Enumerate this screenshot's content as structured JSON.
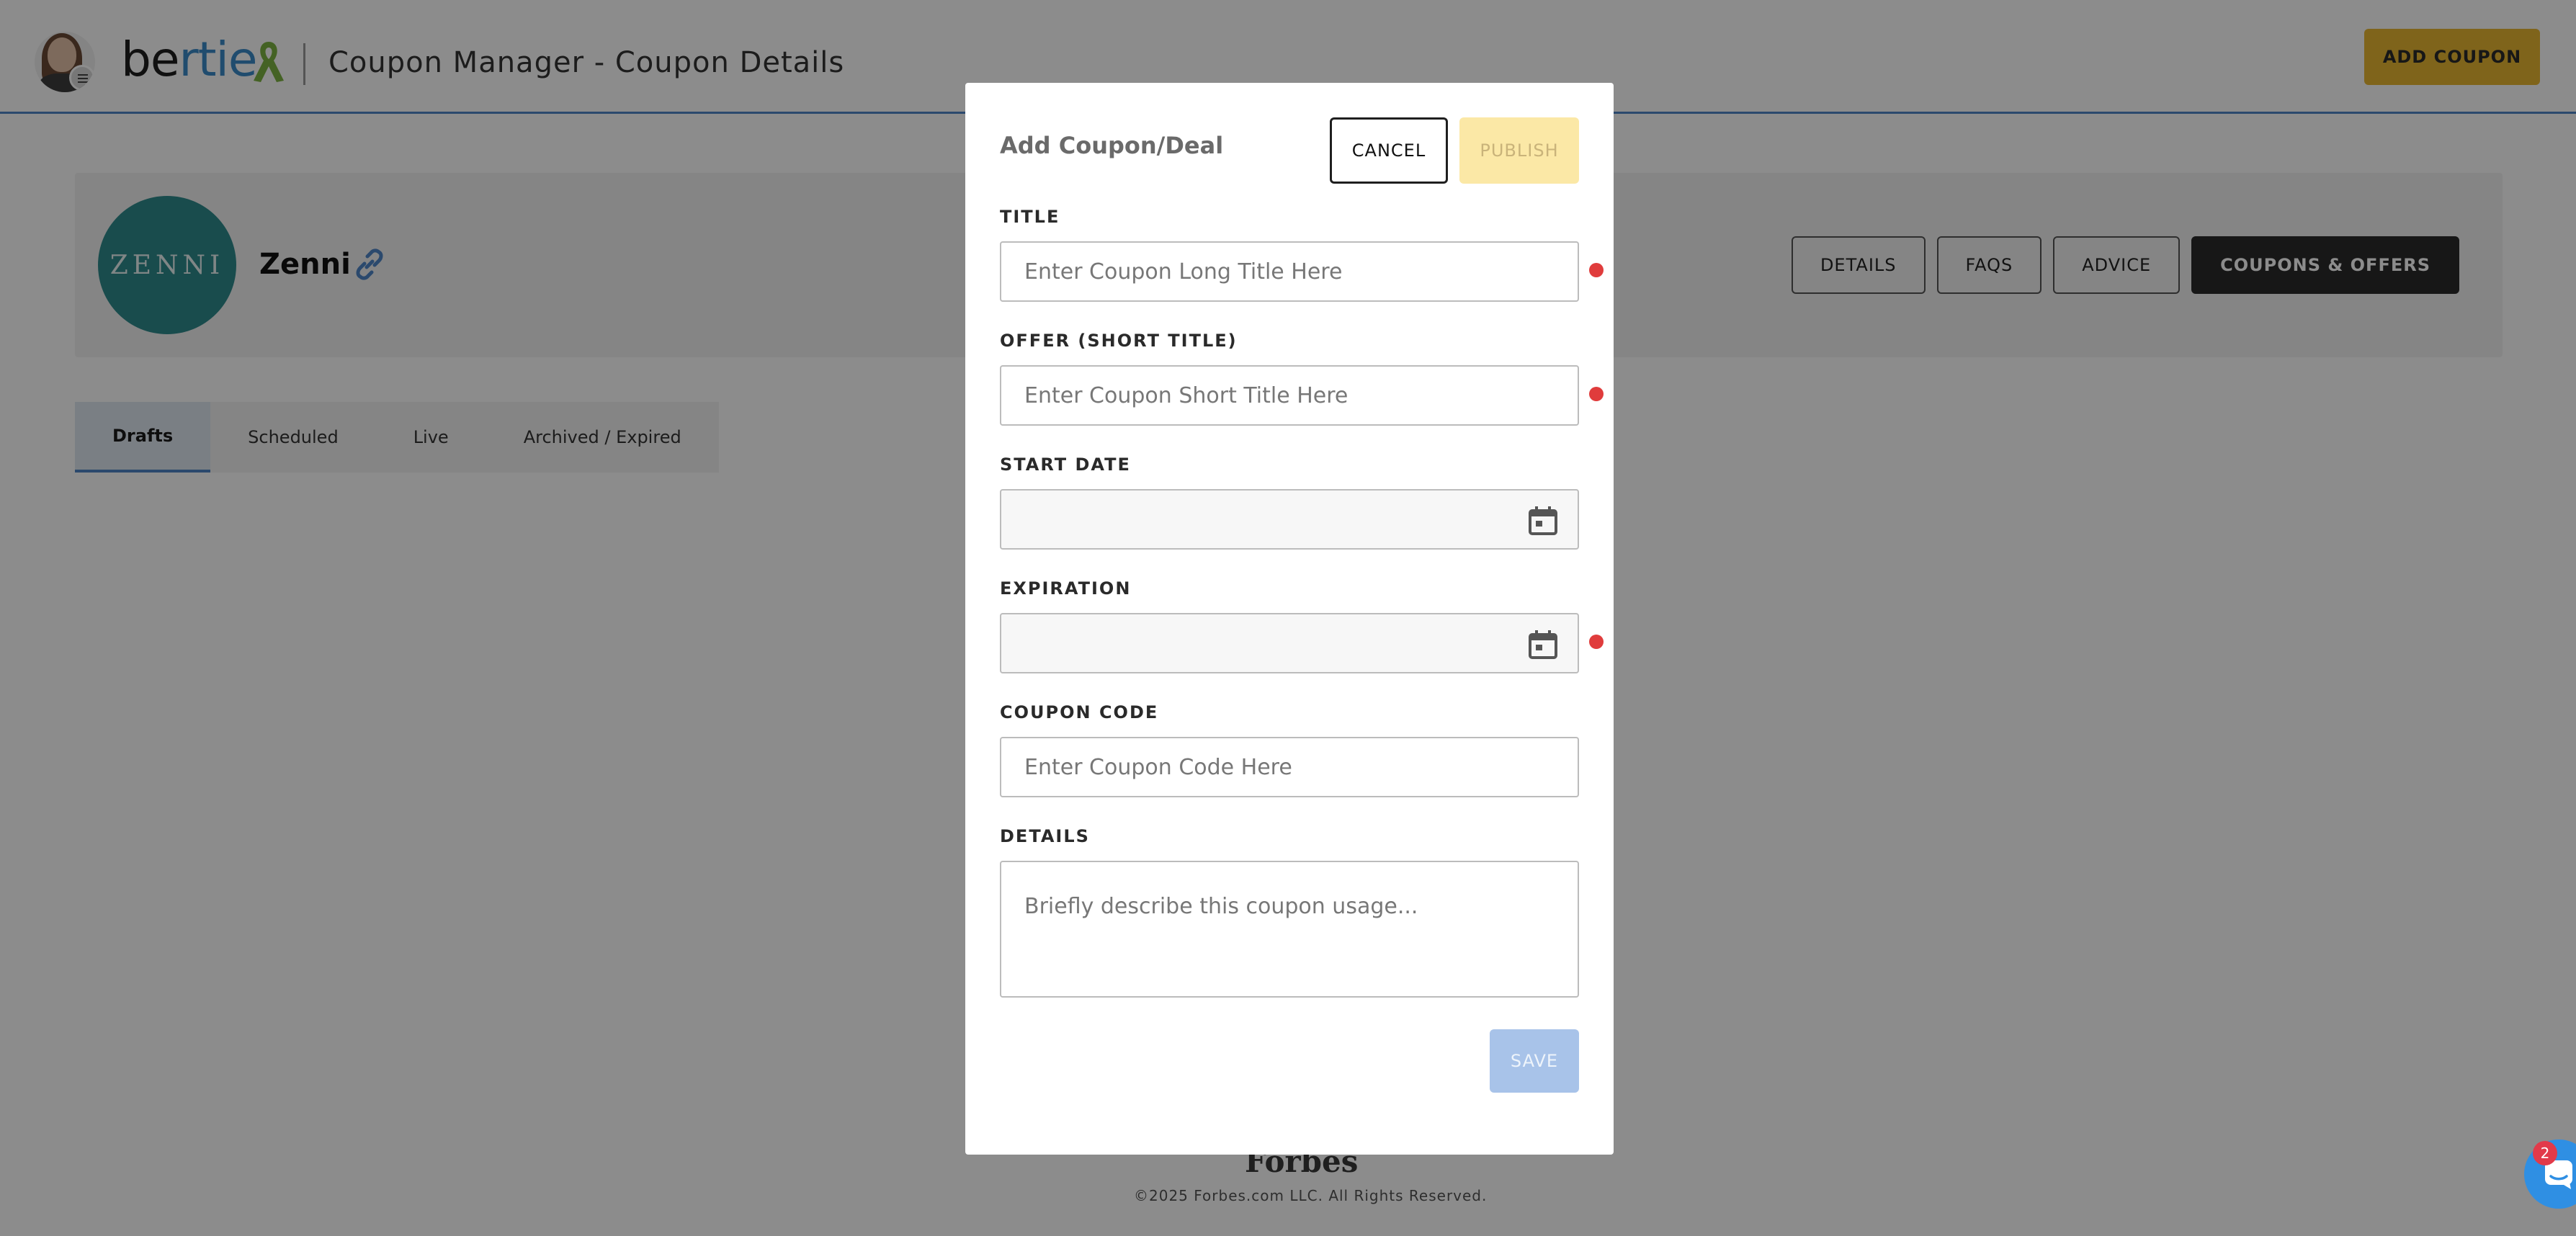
{
  "header": {
    "logo_be": "be",
    "logo_rtie": "rtie",
    "app_title": "Coupon Manager - Coupon Details",
    "add_coupon_label": "ADD COUPON"
  },
  "merchant": {
    "logo_text": "ZENNI",
    "name": "Zenni",
    "nav": [
      {
        "label": "DETAILS"
      },
      {
        "label": "FAQS"
      },
      {
        "label": "ADVICE"
      },
      {
        "label": "COUPONS & OFFERS",
        "active": true
      }
    ]
  },
  "tabs": [
    {
      "label": "Drafts",
      "active": true
    },
    {
      "label": "Scheduled"
    },
    {
      "label": "Live"
    },
    {
      "label": "Archived / Expired"
    }
  ],
  "footer": {
    "brand": "Forbes",
    "copyright": "©2025 Forbes.com LLC. All Rights Reserved."
  },
  "modal": {
    "title": "Add Coupon/Deal",
    "cancel_label": "CANCEL",
    "publish_label": "PUBLISH",
    "save_label": "SAVE",
    "fields": {
      "title": {
        "label": "TITLE",
        "placeholder": "Enter Coupon Long Title Here",
        "value": "",
        "required": true
      },
      "offer": {
        "label": "OFFER (SHORT TITLE)",
        "placeholder": "Enter Coupon Short Title Here",
        "value": "",
        "required": true
      },
      "start_date": {
        "label": "START DATE",
        "value": "",
        "required": false
      },
      "expiration": {
        "label": "EXPIRATION",
        "value": "",
        "required": true
      },
      "coupon_code": {
        "label": "COUPON CODE",
        "placeholder": "Enter Coupon Code Here",
        "value": "",
        "required": false
      },
      "details": {
        "label": "DETAILS",
        "placeholder": "Briefly describe this coupon usage...",
        "value": "",
        "required": false
      }
    }
  },
  "chat": {
    "badge_count": "2"
  },
  "colors": {
    "brand_blue": "#3b8ac8",
    "add_coupon_yellow": "#e8b732",
    "publish_disabled": "#fbe8a6",
    "save_disabled": "#a8c3e9",
    "required_dot": "#e03c3c",
    "merchant_teal": "#2f8a8c",
    "chat_blue": "#2f8fe3"
  }
}
